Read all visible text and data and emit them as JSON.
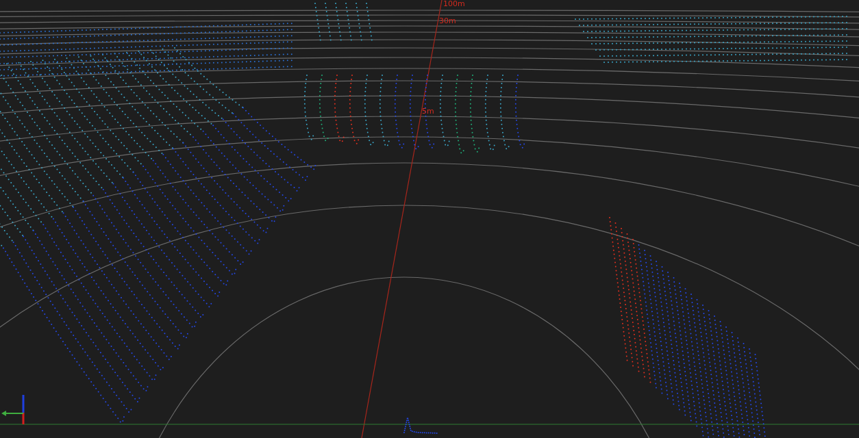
{
  "viewport": {
    "distance_labels": [
      "100m",
      "30m",
      "5m"
    ]
  }
}
